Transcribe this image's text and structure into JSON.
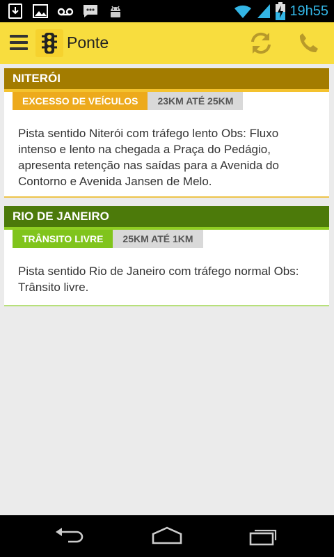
{
  "status_bar": {
    "time": "19h55",
    "icons": [
      "download-icon",
      "image-icon",
      "voicemail-icon",
      "chat-icon",
      "android-icon",
      "wifi-icon",
      "signal-icon",
      "battery-charging-icon"
    ]
  },
  "action_bar": {
    "title": "Ponte",
    "icons": [
      "menu-icon",
      "traffic-light-icon",
      "refresh-icon",
      "phone-icon"
    ],
    "accent": "#f8dd3e"
  },
  "cards": [
    {
      "title": "NITERÓI",
      "status": "EXCESSO DE VEÍCULOS",
      "km": "23KM ATÉ 25KM",
      "text": "Pista sentido Niterói com tráfego lento Obs: Fluxo intenso e lento na chegada a Praça do Pedágio, apresenta retenção nas saídas para a Avenida do Contorno e Avenida Jansen de Melo.",
      "header_color": "#a37c00",
      "status_color": "#edaa1c"
    },
    {
      "title": "RIO DE JANEIRO",
      "status": "TRÂNSITO LIVRE",
      "km": "25KM ATÉ 1KM",
      "text": "Pista sentido Rio de Janeiro com tráfego normal Obs: Trânsito livre.",
      "header_color": "#4c7a0a",
      "status_color": "#80c41c"
    }
  ],
  "nav_bar": {
    "icons": [
      "back-icon",
      "home-icon",
      "recent-apps-icon"
    ]
  }
}
